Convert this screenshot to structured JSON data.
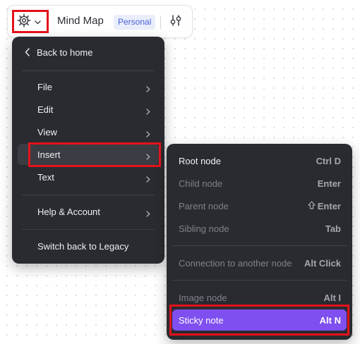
{
  "toolbar": {
    "title": "Mind Map",
    "badge": "Personal",
    "settings_icon": "gear-icon",
    "menu_icon": "chevron-down-icon",
    "adjust_icon": "sliders-icon"
  },
  "main_menu": {
    "back": "Back to home",
    "items": [
      {
        "label": "File"
      },
      {
        "label": "Edit"
      },
      {
        "label": "View"
      },
      {
        "label": "Insert"
      },
      {
        "label": "Text"
      },
      {
        "label": "Help & Account"
      }
    ],
    "legacy": "Switch back to Legacy"
  },
  "insert_menu": {
    "items": [
      {
        "label": "Root node",
        "shortcut": "Ctrl D",
        "enabled": true
      },
      {
        "label": "Child node",
        "shortcut": "Enter",
        "enabled": false
      },
      {
        "label": "Parent node",
        "shortcut": "Enter",
        "shortcut_icon": "shift-icon",
        "enabled": false
      },
      {
        "label": "Sibling node",
        "shortcut": "Tab",
        "enabled": false
      },
      {
        "label": "Connection to another node",
        "shortcut": "Alt Click",
        "enabled": false
      },
      {
        "label": "Image node",
        "shortcut": "Alt I",
        "enabled": false
      },
      {
        "label": "Sticky note",
        "shortcut": "Alt N",
        "enabled": true,
        "selected": true
      }
    ]
  },
  "colors": {
    "menu_bg": "#2a2b30",
    "selected": "#7f4ff0",
    "highlight": "#e3121b",
    "badge_bg": "#eaeefc",
    "badge_text": "#4a5fd6"
  }
}
